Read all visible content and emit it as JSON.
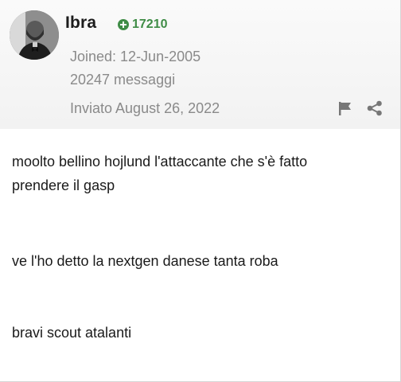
{
  "author": {
    "name": "Ibra",
    "reputation": "17210",
    "joined": "Joined: 12-Jun-2005",
    "posts": "20247 messaggi"
  },
  "post": {
    "date": "Inviato August 26, 2022",
    "paragraphs": [
      "moolto bellino hojlund l'attaccante che s'è fatto prendere il gasp",
      "ve l'ho detto la nextgen danese tanta roba",
      "bravi scout atalanti"
    ]
  },
  "icons": {
    "reputation": "plus-circle-icon",
    "report": "flag-icon",
    "share": "share-icon"
  },
  "colors": {
    "reputation": "#3f8c46",
    "meta_text": "#8a8a8a",
    "icon": "#777777"
  }
}
